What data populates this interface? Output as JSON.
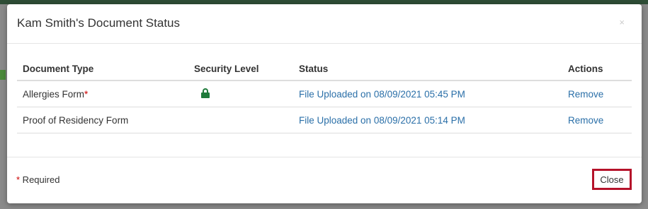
{
  "modal": {
    "title": "Kam Smith's Document Status",
    "close_icon": "×",
    "table": {
      "headers": [
        "Document Type",
        "Security Level",
        "Status",
        "Actions"
      ],
      "rows": [
        {
          "document_type": "Allergies Form",
          "required_mark": "*",
          "security_icon": "lock-icon",
          "status": "File Uploaded on 08/09/2021 05:45 PM",
          "action": "Remove"
        },
        {
          "document_type": "Proof of Residency Form",
          "required_mark": "",
          "security_icon": "",
          "status": "File Uploaded on 08/09/2021 05:14 PM",
          "action": "Remove"
        }
      ]
    },
    "footer": {
      "required_star": "*",
      "required_text": " Required",
      "close_label": "Close"
    }
  },
  "colors": {
    "link": "#2a6fa8",
    "lock": "#1e7a3a",
    "required_star": "#cc0000",
    "close_highlight": "#b5122a"
  }
}
